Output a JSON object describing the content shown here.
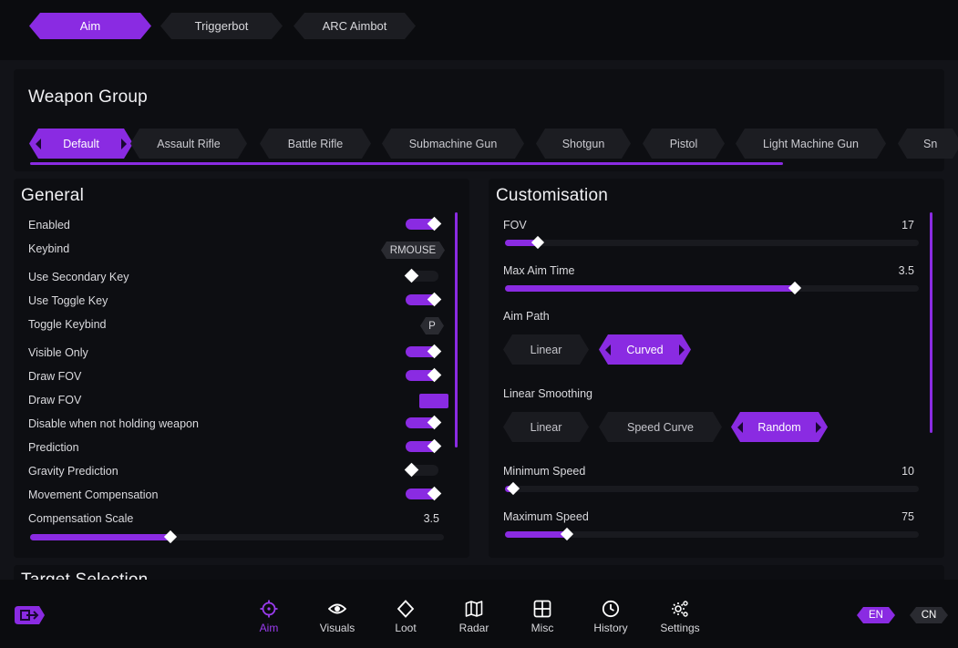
{
  "top_tabs": [
    {
      "label": "Aim",
      "active": true
    },
    {
      "label": "Triggerbot",
      "active": false
    },
    {
      "label": "ARC Aimbot",
      "active": false
    }
  ],
  "weapon_group": {
    "title": "Weapon Group",
    "chips": [
      {
        "label": "Default",
        "active": true
      },
      {
        "label": "Assault Rifle",
        "active": false
      },
      {
        "label": "Battle Rifle",
        "active": false
      },
      {
        "label": "Submachine Gun",
        "active": false
      },
      {
        "label": "Shotgun",
        "active": false
      },
      {
        "label": "Pistol",
        "active": false
      },
      {
        "label": "Light Machine Gun",
        "active": false
      },
      {
        "label": "Sn",
        "active": false
      }
    ]
  },
  "general": {
    "title": "General",
    "rows": {
      "enabled": {
        "label": "Enabled",
        "value": true
      },
      "keybind": {
        "label": "Keybind",
        "key": "RMOUSE"
      },
      "use_secondary_key": {
        "label": "Use Secondary Key",
        "value": false
      },
      "use_toggle_key": {
        "label": "Use Toggle Key",
        "value": true
      },
      "toggle_keybind": {
        "label": "Toggle Keybind",
        "key": "P"
      },
      "visible_only": {
        "label": "Visible Only",
        "value": true
      },
      "draw_fov_toggle": {
        "label": "Draw FOV",
        "value": true
      },
      "draw_fov_color": {
        "label": "Draw FOV",
        "color": "#8a2be2"
      },
      "disable_not_holding": {
        "label": "Disable when not holding weapon",
        "value": true
      },
      "prediction": {
        "label": "Prediction",
        "value": true
      },
      "gravity_prediction": {
        "label": "Gravity Prediction",
        "value": false
      },
      "movement_compensation": {
        "label": "Movement Compensation",
        "value": true
      },
      "compensation_scale": {
        "label": "Compensation Scale",
        "value": "3.5",
        "fraction": 0.34
      }
    }
  },
  "customisation": {
    "title": "Customisation",
    "fov": {
      "label": "FOV",
      "value": "17",
      "fraction": 0.08
    },
    "max_aim_time": {
      "label": "Max Aim Time",
      "value": "3.5",
      "fraction": 0.7
    },
    "aim_path": {
      "label": "Aim Path",
      "options": [
        {
          "label": "Linear",
          "active": false
        },
        {
          "label": "Curved",
          "active": true
        }
      ]
    },
    "linear_smoothing": {
      "label": "Linear Smoothing",
      "options": [
        {
          "label": "Linear",
          "active": false
        },
        {
          "label": "Speed Curve",
          "active": false
        },
        {
          "label": "Random",
          "active": true
        }
      ]
    },
    "minimum_speed": {
      "label": "Minimum Speed",
      "value": "10",
      "fraction": 0.02
    },
    "maximum_speed": {
      "label": "Maximum Speed",
      "value": "75",
      "fraction": 0.15
    }
  },
  "next_section_title": "Target Selection",
  "bottom_nav": [
    {
      "label": "Aim",
      "icon": "crosshair-icon",
      "active": true
    },
    {
      "label": "Visuals",
      "icon": "eye-icon",
      "active": false
    },
    {
      "label": "Loot",
      "icon": "diamond-icon",
      "active": false
    },
    {
      "label": "Radar",
      "icon": "map-icon",
      "active": false
    },
    {
      "label": "Misc",
      "icon": "grid-icon",
      "active": false
    },
    {
      "label": "History",
      "icon": "clock-icon",
      "active": false
    },
    {
      "label": "Settings",
      "icon": "gear-icon",
      "active": false
    }
  ],
  "languages": [
    {
      "label": "EN",
      "active": true
    },
    {
      "label": "CN",
      "active": false
    }
  ],
  "colors": {
    "accent": "#8a2be2",
    "background": "#0b0c0f",
    "panel": "#0d0e12"
  }
}
